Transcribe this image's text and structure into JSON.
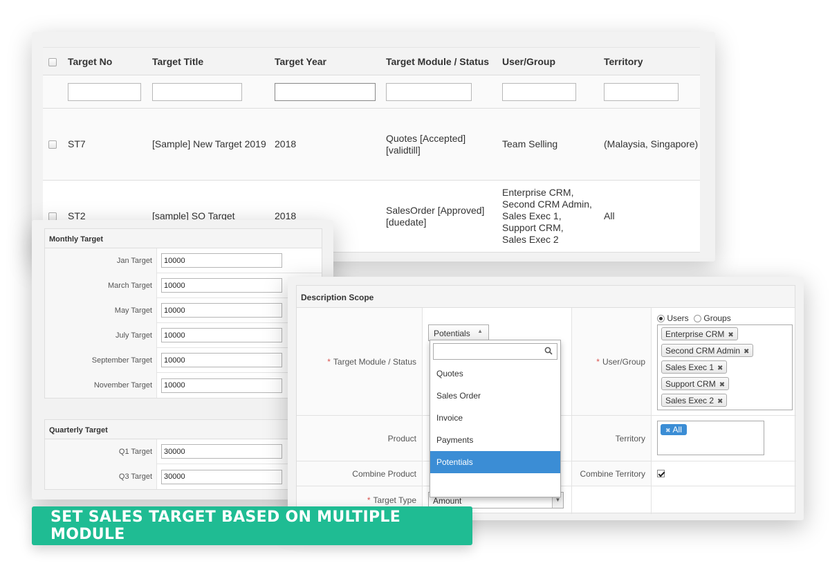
{
  "list": {
    "columns": [
      "Target No",
      "Target Title",
      "Target Year",
      "Target Module / Status",
      "User/Group",
      "Territory"
    ],
    "rows": [
      {
        "no": "ST7",
        "title": "[Sample] New Target 2019",
        "year": "2018",
        "module_l1": "Quotes [Accepted]",
        "module_l2": "[validtill]",
        "users": [
          "Team Selling"
        ],
        "territory": "(Malaysia, Singapore)"
      },
      {
        "no": "ST2",
        "title": "[sample] SO Target",
        "year": "2018",
        "module_l1": "SalesOrder [Approved]",
        "module_l2": "[duedate]",
        "users": [
          "Enterprise CRM,",
          "Second CRM Admin,",
          "Sales Exec 1,",
          "Support CRM,",
          "Sales Exec 2"
        ],
        "territory": "All"
      }
    ]
  },
  "monthly": {
    "title": "Monthly Target",
    "rows": [
      {
        "label": "Jan Target",
        "value": "10000"
      },
      {
        "label": "March Target",
        "value": "10000"
      },
      {
        "label": "May Target",
        "value": "10000"
      },
      {
        "label": "July Target",
        "value": "10000"
      },
      {
        "label": "September Target",
        "value": "10000"
      },
      {
        "label": "November Target",
        "value": "10000"
      }
    ]
  },
  "quarterly": {
    "title": "Quarterly Target",
    "rows": [
      {
        "label": "Q1 Target",
        "value": "30000"
      },
      {
        "label": "Q3 Target",
        "value": "30000"
      }
    ]
  },
  "scope": {
    "title": "Description Scope",
    "module_label": "Target Module / Status",
    "module_selected": "Potentials",
    "module_options": [
      "Quotes",
      "Sales Order",
      "Invoice",
      "Payments",
      "Potentials"
    ],
    "user_group_label": "User/Group",
    "radio_users": "Users",
    "radio_groups": "Groups",
    "users": [
      "Enterprise CRM",
      "Second CRM Admin",
      "Sales Exec 1",
      "Support CRM",
      "Sales Exec 2"
    ],
    "product_label": "Product",
    "territory_label": "Territory",
    "territory_value": "All",
    "combine_product_label": "Combine Product",
    "combine_territory_label": "Combine Territory",
    "target_type_label": "Target Type",
    "target_type_value": "Amount",
    "required_mark": "*"
  },
  "banner": {
    "text": "SET SALES TARGET BASED ON MULTIPLE MODULE",
    "color": "#1fbc93"
  },
  "colors": {
    "selected_option": "#3b8dd5",
    "required": "#d9534f"
  }
}
